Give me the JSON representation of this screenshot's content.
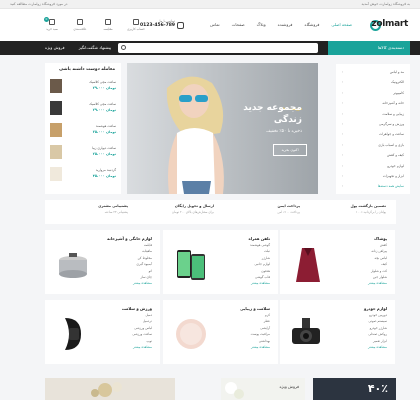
{
  "topbar": {
    "left": "در مورد فروشگاه زولمارت مطالعه کنید",
    "right": "به فروشگاه زولمارت خوش آمدید"
  },
  "header": {
    "logo": "zolmart",
    "nav": [
      "صفحه اصلی",
      "فروشگاه",
      "فروشنده",
      "وبلاگ",
      "صفحات",
      "تماس"
    ],
    "phone_label": "تماس با ما",
    "phone_number": "0123-456-789",
    "icons": [
      {
        "name": "cart-icon",
        "label": "سبد خرید"
      },
      {
        "name": "wishlist-icon",
        "label": "علاقه‌مندی"
      },
      {
        "name": "compare-icon",
        "label": "مقایسه"
      },
      {
        "name": "account-icon",
        "label": "حساب کاربری"
      }
    ],
    "cart_count": "0"
  },
  "navbar": {
    "category_button": "دسته‌بندی کالاها",
    "search_placeholder": "",
    "offers": [
      "پیشنهاد شگفت‌انگیز",
      "فروش ویژه"
    ]
  },
  "categories": [
    "مد و لباس",
    "الکترونیک",
    "کامپیوتر",
    "خانه و آشپزخانه",
    "زیبایی و سلامت",
    "ورزش و سرگرمی",
    "ساعت و جواهرات",
    "بازی و اسباب بازی",
    "کیف و کفش",
    "لوازم خودرو",
    "ابزار و تجهیزات",
    "نمایش همه دسته‌ها"
  ],
  "hero": {
    "eyebrow": "فروشنده ها",
    "title_line1": "مجموعه جدید",
    "title_line2": "زندگی",
    "subtitle": "ذخیره تا ۵۰٪ تخفیف",
    "button": "اکنون بخرید"
  },
  "specials": {
    "title": "معامله دوست داشته باشی",
    "items": [
      {
        "name": "ساعت مچی کلاسیک",
        "price": "۲۹،۰۰۰ تومان"
      },
      {
        "name": "ساعت مچی کلاسیک",
        "price": "۲۹،۰۰۰ تومان"
      },
      {
        "name": "ساعت هوشمند",
        "price": "۳۵،۰۰۰ تومان"
      },
      {
        "name": "ساعت دیواری زیبا",
        "price": "۲۵،۰۰۰ تومان"
      },
      {
        "name": "گردنبند مروارید",
        "price": "۴۵،۰۰۰ تومان"
      }
    ]
  },
  "features": [
    {
      "title": "تضمین بازگشت پول",
      "sub": "۱۰۰٪ پولتان را برگردانید"
    },
    {
      "title": "پرداخت ایمن",
      "sub": "پرداخت ۱۰۰٪ امن"
    },
    {
      "title": "ارسال و تحویل رایگان",
      "sub": "برای سفارش‌های بالای ۲۰۰ تومان"
    },
    {
      "title": "پشتیبانی مشتری",
      "sub": "پشتیبانی ۲۴ ساعته"
    }
  ],
  "cards_row1": [
    {
      "title": "پوشاک",
      "items": [
        "کفش",
        "پیراهن زنانه",
        "لباس بچه",
        "کیف",
        "کت و شلوار",
        "شلوار جین"
      ],
      "more": "مشاهده بیشتر"
    },
    {
      "title": "تلفن همراه",
      "items": [
        "گوشی هوشمند",
        "تبلت",
        "شارژر",
        "لوازم جانبی",
        "هدفون",
        "قاب گوشی"
      ],
      "more": "مشاهده بیشتر"
    },
    {
      "title": "لوازم خانگی و آشپزخانه",
      "items": [
        "قابلمه",
        "ماهیتابه",
        "مخلوط کن",
        "آبمیوه گیری",
        "اتو",
        "چای ساز"
      ],
      "more": "مشاهده بیشتر"
    }
  ],
  "cards_row2": [
    {
      "title": "لوازم خودرو",
      "items": [
        "دوربین خودرو",
        "سیستم صوتی",
        "شارژر خودرو",
        "روکش صندلی",
        "ابزار تعمیر"
      ],
      "more": "مشاهده بیشتر"
    },
    {
      "title": "سلامت و زیبایی",
      "items": [
        "کرم",
        "عطر",
        "آرایشی",
        "مراقبت پوست",
        "بهداشتی"
      ],
      "more": "مشاهده بیشتر"
    },
    {
      "title": "ورزش و سلامت",
      "items": [
        "دمبل",
        "تردمیل",
        "لباس ورزشی",
        "ساعت ورزشی",
        "توپ"
      ],
      "more": "مشاهده بیشتر"
    }
  ],
  "promos": [
    {
      "text": "۴۰٪"
    },
    {
      "text": "فروش ویژه"
    },
    {
      "text": ""
    }
  ],
  "colors": {
    "accent": "#1aa39a",
    "dark": "#222222"
  }
}
